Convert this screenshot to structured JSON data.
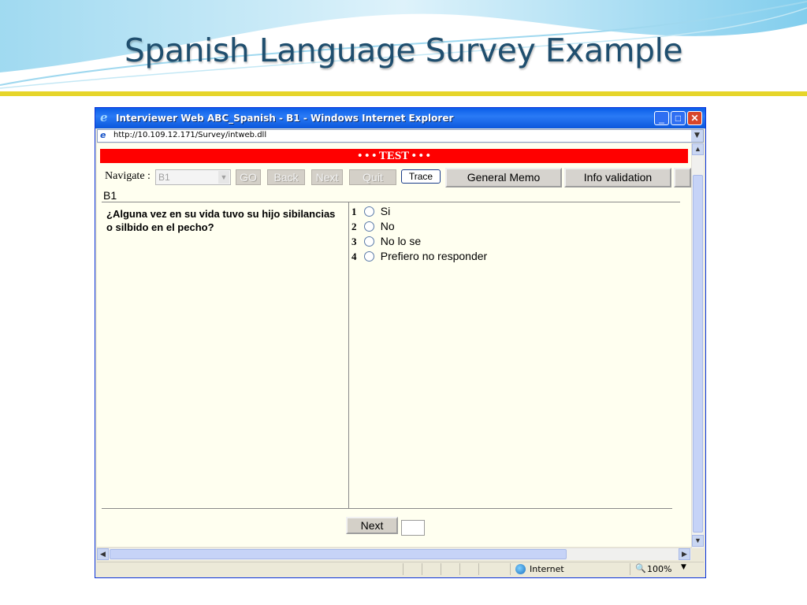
{
  "slide": {
    "title": "Spanish Language Survey Example"
  },
  "browser": {
    "window_title": "Interviewer Web ABC_Spanish - B1 - Windows Internet Explorer",
    "address": "http://10.109.12.171/Survey/intweb.dll",
    "status_zone": "Internet",
    "zoom": "100%"
  },
  "survey": {
    "banner": "• • • TEST • • •",
    "navigate_label": "Navigate :",
    "navigate_value": "B1",
    "buttons": {
      "go": "GO",
      "back": "Back",
      "next": "Next",
      "quit": "Quit",
      "trace": "Trace",
      "general_memo": "General Memo",
      "info_validation": "Info validation"
    },
    "question_id": "B1",
    "question_text": "¿Alguna vez en su vida tuvo su hijo sibilancias o silbido en el pecho?",
    "options": [
      {
        "num": "1",
        "label": "Si"
      },
      {
        "num": "2",
        "label": "No"
      },
      {
        "num": "3",
        "label": "No lo se"
      },
      {
        "num": "4",
        "label": "Prefiero no responder"
      }
    ],
    "next_button": "Next"
  },
  "colors": {
    "title": "#1f4e6e",
    "gold_rule": "#e6d52a",
    "banner": "#ff0000",
    "content_bg": "#fffff0"
  }
}
